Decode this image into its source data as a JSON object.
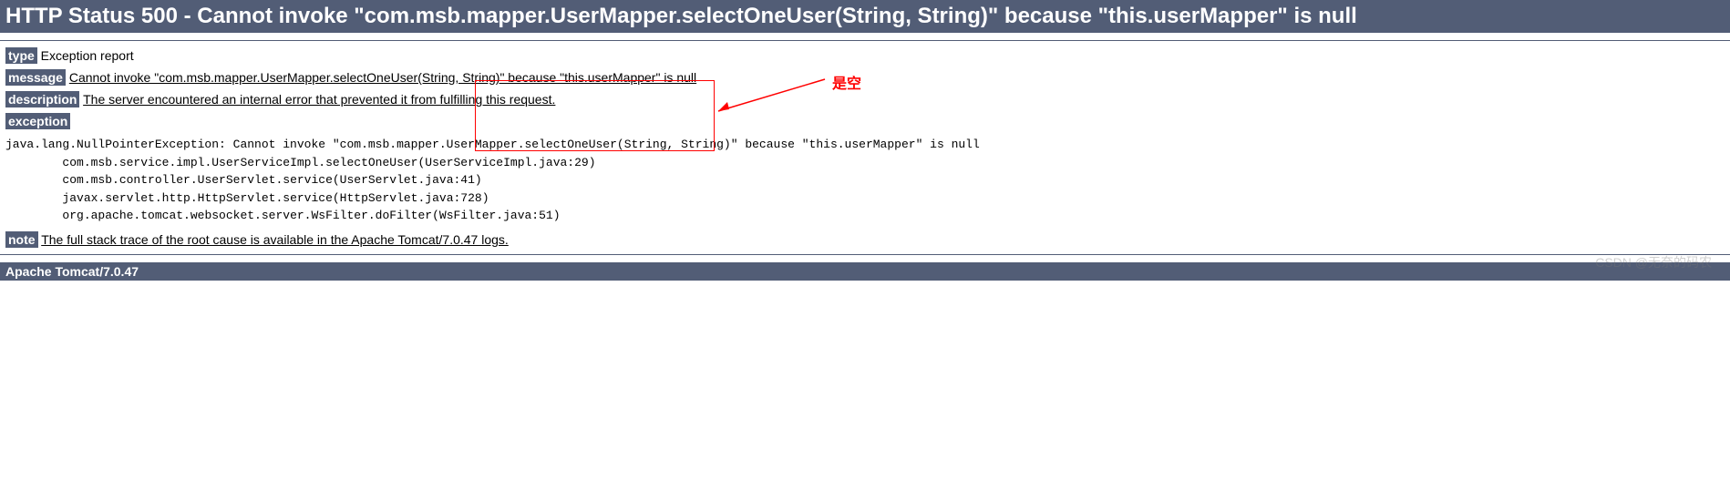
{
  "header": {
    "title": "HTTP Status 500 - Cannot invoke \"com.msb.mapper.UserMapper.selectOneUser(String, String)\" because \"this.userMapper\" is null"
  },
  "sections": {
    "type": {
      "label": "type",
      "value": " Exception report"
    },
    "message": {
      "label": "message",
      "value": "Cannot invoke \"com.msb.mapper.UserMapper.selectOneUser(String, String)\" because \"this.userMapper\" is null"
    },
    "description": {
      "label": "description",
      "value": "The server encountered an internal error that prevented it from fulfilling this request."
    },
    "exception": {
      "label": "exception"
    },
    "note": {
      "label": "note",
      "value": "The full stack trace of the root cause is available in the Apache Tomcat/7.0.47 logs."
    }
  },
  "stacktrace": "java.lang.NullPointerException: Cannot invoke \"com.msb.mapper.UserMapper.selectOneUser(String, String)\" because \"this.userMapper\" is null\n\tcom.msb.service.impl.UserServiceImpl.selectOneUser(UserServiceImpl.java:29)\n\tcom.msb.controller.UserServlet.service(UserServlet.java:41)\n\tjavax.servlet.http.HttpServlet.service(HttpServlet.java:728)\n\torg.apache.tomcat.websocket.server.WsFilter.doFilter(WsFilter.java:51)",
  "footer": {
    "server": "Apache Tomcat/7.0.47"
  },
  "annotations": {
    "callout_text": "是空"
  },
  "watermark": "CSDN @无奈的码农"
}
